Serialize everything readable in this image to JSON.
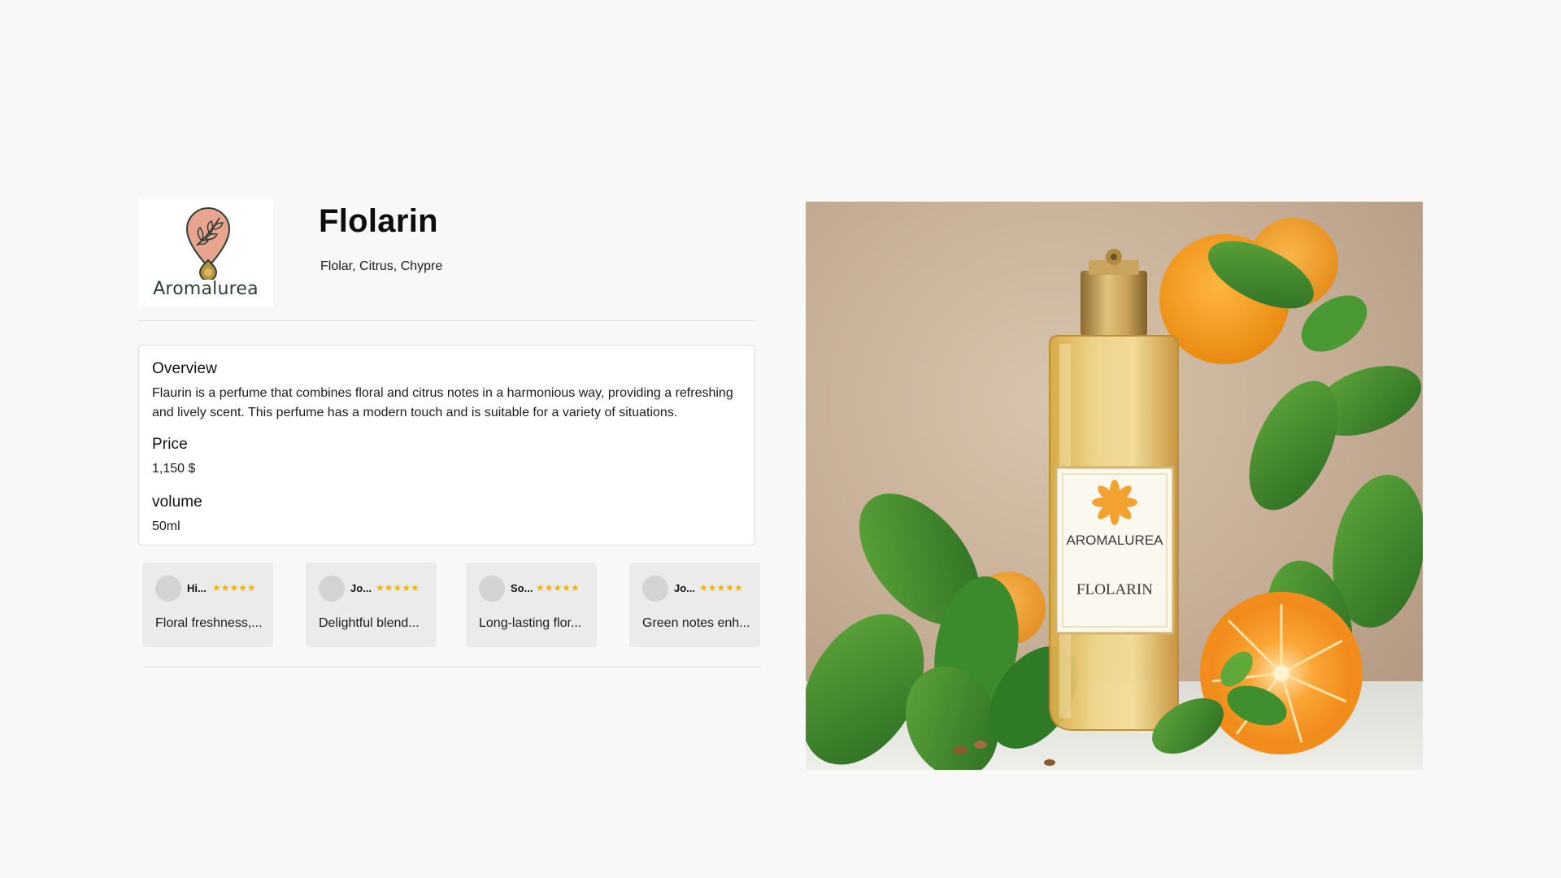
{
  "brand": {
    "name": "Aromalurea",
    "logo_icon": "leaf-drop-logo-icon"
  },
  "product": {
    "title": "Flolarin",
    "notes": "Flolar, Citrus, Chypre",
    "image_icon": "perfume-bottle-with-oranges-and-mint-image",
    "bottle_label_brand": "AROMALUREA",
    "bottle_label_name": "FLOLARIN"
  },
  "details": {
    "overview_heading": "Overview",
    "overview_text": "Flaurin is a perfume that combines floral and citrus notes in a harmonious way, providing a refreshing and lively scent. This perfume has a modern touch and is suitable for a variety of situations.",
    "price_heading": "Price",
    "price_value": "1,150 $",
    "volume_heading": "volume",
    "volume_value": "50ml"
  },
  "reviews": [
    {
      "name": "Hi...",
      "stars": "★★★★★",
      "rating": 5,
      "text": "Floral freshness,..."
    },
    {
      "name": "Jo...",
      "stars": "★★★★★",
      "rating": 5,
      "text": "Delightful blend..."
    },
    {
      "name": "So...",
      "stars": "★★★★★",
      "rating": 5,
      "text": "Long-lasting flor..."
    },
    {
      "name": "Jo...",
      "stars": "★★★★★",
      "rating": 5,
      "text": "Green notes enh..."
    }
  ],
  "colors": {
    "background": "#f8f8f8",
    "card": "#ffffff",
    "review_card": "#ebebeb",
    "star": "#f4b400",
    "logo_pink": "#e8a48f",
    "logo_green": "#2f3f35"
  }
}
